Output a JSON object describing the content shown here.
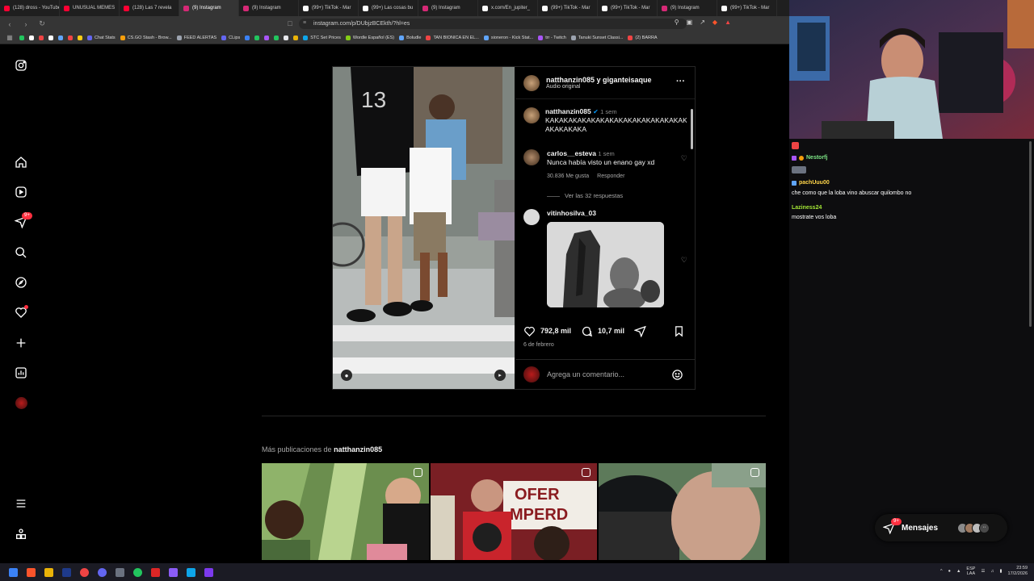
{
  "browser": {
    "tabs": [
      {
        "label": "(128) dross - YouTube",
        "color": "#ff0033"
      },
      {
        "label": "UNUSUAL MEMES",
        "color": "#ff0033"
      },
      {
        "label": "(128) Las 7 revela",
        "color": "#ff0033"
      },
      {
        "label": "(9) Instagram",
        "color": "#d62976"
      },
      {
        "label": "(9) Instagram",
        "color": "#d62976"
      },
      {
        "label": "(99+) TikTok - Mar",
        "color": "#ffffff"
      },
      {
        "label": "(99+) Las cosas bu",
        "color": "#ffffff"
      },
      {
        "label": "(9) Instagram",
        "color": "#d62976"
      },
      {
        "label": "x.com/En_jupiter_",
        "color": "#ffffff"
      },
      {
        "label": "(99+) TikTok - Mar",
        "color": "#ffffff"
      },
      {
        "label": "(99+) TikTok - Mar",
        "color": "#ffffff"
      },
      {
        "label": "(9) Instagram",
        "color": "#d62976"
      },
      {
        "label": "(99+) TikTok - Mar",
        "color": "#ffffff"
      }
    ],
    "url": "instagram.com/p/DUbjzBCEkth/?hl=es",
    "bookmarks": [
      {
        "label": "",
        "color": "#22c55e"
      },
      {
        "label": "",
        "color": "#ffffff"
      },
      {
        "label": "",
        "color": "#ef4444"
      },
      {
        "label": "",
        "color": "#ffffff"
      },
      {
        "label": "",
        "color": "#60a5fa"
      },
      {
        "label": "",
        "color": "#ef4444"
      },
      {
        "label": "",
        "color": "#facc15"
      },
      {
        "label": "Chat Stats",
        "color": "#6366f1"
      },
      {
        "label": "CS.GO Stash - Brow...",
        "color": "#f59e0b"
      },
      {
        "label": "FEED ALERTAS",
        "color": "#9ca3af"
      },
      {
        "label": "CLips",
        "color": "#6366f1"
      },
      {
        "label": "",
        "color": "#3b82f6"
      },
      {
        "label": "",
        "color": "#22c55e"
      },
      {
        "label": "",
        "color": "#a855f7"
      },
      {
        "label": "",
        "color": "#22c55e"
      },
      {
        "label": "",
        "color": "#e5e7eb"
      },
      {
        "label": "",
        "color": "#eab308"
      },
      {
        "label": "STC Set Prices",
        "color": "#0ea5e9"
      },
      {
        "label": "Wordle Español (ES)",
        "color": "#84cc16"
      },
      {
        "label": "Boludle",
        "color": "#60a5fa"
      },
      {
        "label": "TAN BIONICA EN EL...",
        "color": "#ef4444"
      },
      {
        "label": "sioneron - Kick Stat...",
        "color": "#60a5fa"
      },
      {
        "label": "trr - Twitch",
        "color": "#a855f7"
      },
      {
        "label": "Tanuki Sunset Classi...",
        "color": "#9ca3af"
      },
      {
        "label": "(2) BARRA",
        "color": "#ef4444"
      }
    ]
  },
  "post": {
    "header_user": "natthanzin085 y giganteisaque",
    "header_sub": "Audio original",
    "comments": [
      {
        "user": "natthanzin085",
        "time": "1 sem",
        "text": "KAKAKAKAKAKAKAKAKAKAKAKAKAKAKAKAKAKAKAKA",
        "verified": true
      },
      {
        "user": "carlos__esteva",
        "time": "1 sem",
        "text": "Nunca había visto un enano gay xd",
        "likes": "30.836 Me gusta",
        "reply": "Responder",
        "replies": "Ver las 32 respuestas"
      },
      {
        "user": "vitinhosilva_03",
        "time": "",
        "text": ""
      }
    ],
    "likes": "792,8 mil",
    "comments_count": "10,7 mil",
    "date": "6 de febrero",
    "add_comment_placeholder": "Agrega un comentario..."
  },
  "more_posts": {
    "prefix": "Más publicaciones de",
    "user": "natthanzin085"
  },
  "messages": {
    "label": "Mensajes",
    "badge": "9+"
  },
  "sidenav": {
    "notification_badge": "9+"
  },
  "chat": [
    {
      "user": "Nestorfj",
      "text": "",
      "color": "#7ee787"
    },
    {
      "user": "pachUuu00",
      "text": "che como que la loba vino abuscar quilombo no",
      "color": "#ffd54a"
    },
    {
      "user": "Laziness24",
      "text": "mostrate vos loba",
      "color": "#a3e635"
    }
  ],
  "tray": {
    "lang": "ESP\nLAA",
    "time": "23:59",
    "date": "17/2/2026"
  }
}
